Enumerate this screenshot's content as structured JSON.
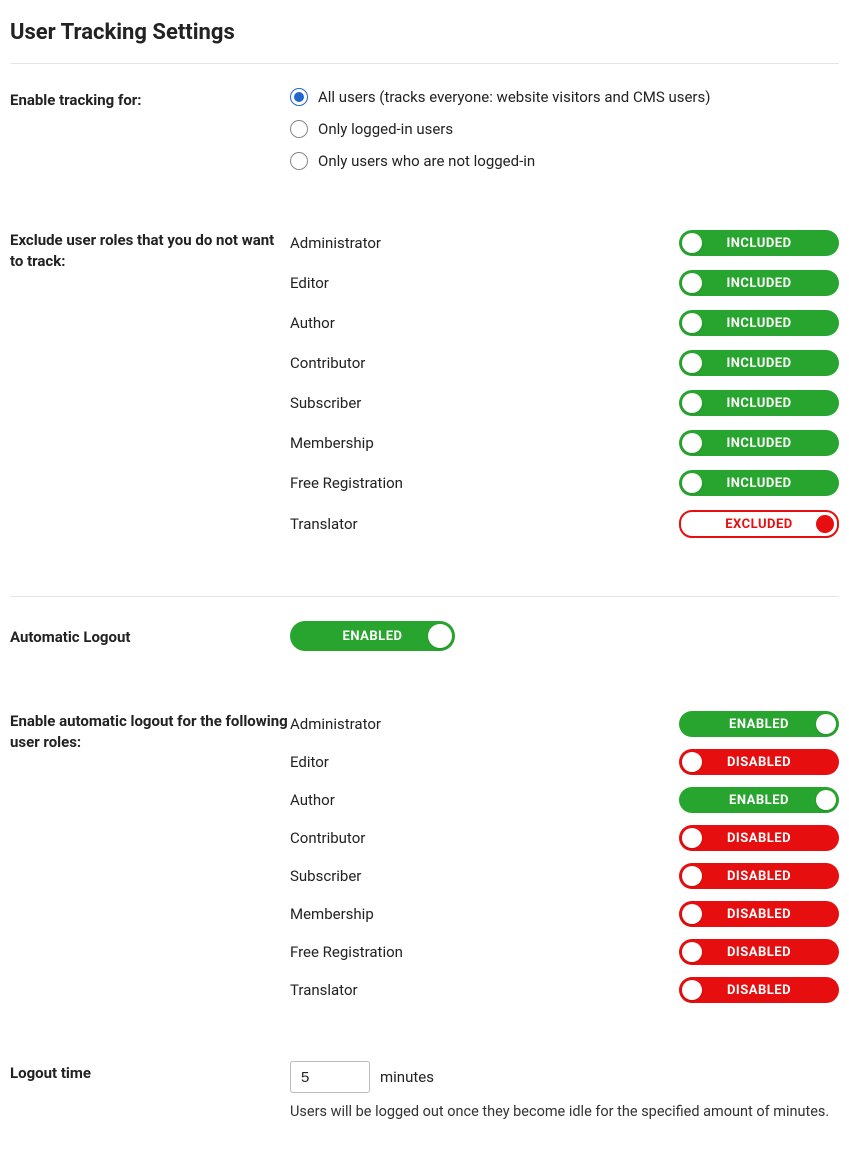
{
  "page_title": "User Tracking Settings",
  "enable_tracking": {
    "label": "Enable tracking for:",
    "options": [
      {
        "label": "All users (tracks everyone: website visitors and CMS users)",
        "selected": true
      },
      {
        "label": "Only logged-in users",
        "selected": false
      },
      {
        "label": "Only users who are not logged-in",
        "selected": false
      }
    ]
  },
  "exclude_roles": {
    "label": "Exclude user roles that you do not want to track:",
    "roles": [
      {
        "name": "Administrator",
        "state": "INCLUDED"
      },
      {
        "name": "Editor",
        "state": "INCLUDED"
      },
      {
        "name": "Author",
        "state": "INCLUDED"
      },
      {
        "name": "Contributor",
        "state": "INCLUDED"
      },
      {
        "name": "Subscriber",
        "state": "INCLUDED"
      },
      {
        "name": "Membership",
        "state": "INCLUDED"
      },
      {
        "name": "Free Registration",
        "state": "INCLUDED"
      },
      {
        "name": "Translator",
        "state": "EXCLUDED"
      }
    ]
  },
  "auto_logout": {
    "label": "Automatic Logout",
    "state": "ENABLED"
  },
  "auto_logout_roles": {
    "label": "Enable automatic logout for the following user roles:",
    "roles": [
      {
        "name": "Administrator",
        "state": "ENABLED"
      },
      {
        "name": "Editor",
        "state": "DISABLED"
      },
      {
        "name": "Author",
        "state": "ENABLED"
      },
      {
        "name": "Contributor",
        "state": "DISABLED"
      },
      {
        "name": "Subscriber",
        "state": "DISABLED"
      },
      {
        "name": "Membership",
        "state": "DISABLED"
      },
      {
        "name": "Free Registration",
        "state": "DISABLED"
      },
      {
        "name": "Translator",
        "state": "DISABLED"
      }
    ]
  },
  "logout_time": {
    "label": "Logout time",
    "value": "5",
    "unit": "minutes",
    "help": "Users will be logged out once they become idle for the specified amount of minutes."
  }
}
